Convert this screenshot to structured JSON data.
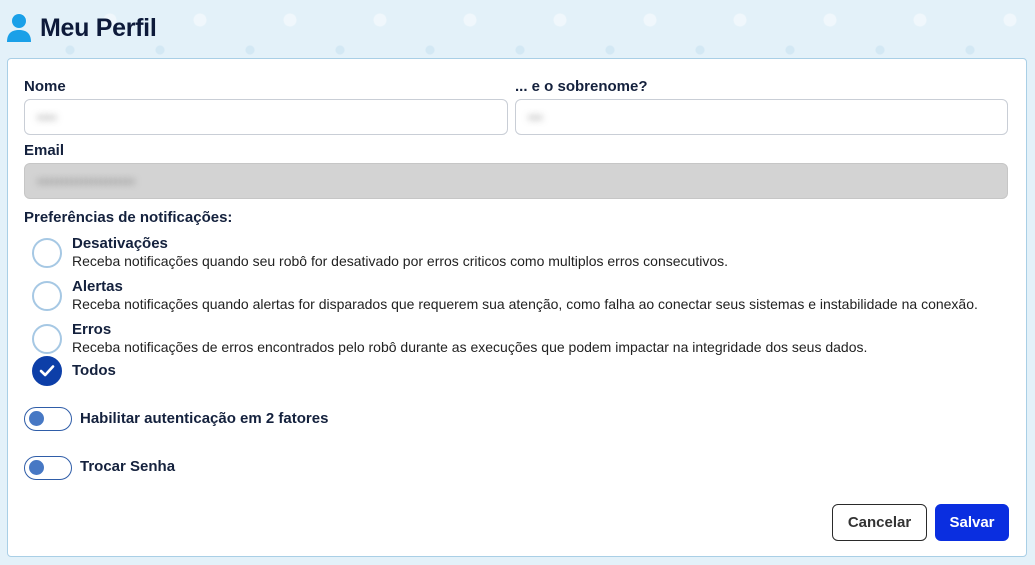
{
  "header": {
    "icon": "user-icon",
    "title": "Meu Perfil"
  },
  "form": {
    "first_name": {
      "label": "Nome",
      "value": "••••",
      "placeholder": ""
    },
    "last_name": {
      "label": "... e o sobrenome?",
      "value": "•••",
      "placeholder": ""
    },
    "email": {
      "label": "Email",
      "value": "••••••••••••••••••••",
      "disabled": true
    }
  },
  "notifications": {
    "title": "Preferências de notificações:",
    "options": [
      {
        "label": "Desativações",
        "description": "Receba notificações quando seu robô for desativado por erros criticos como multiplos erros consecutivos.",
        "checked": false
      },
      {
        "label": "Alertas",
        "description": "Receba notificações quando alertas for disparados que requerem sua atenção, como falha ao conectar seus sistemas e instabilidade na conexão.",
        "checked": false
      },
      {
        "label": "Erros",
        "description": "Receba notificações de erros encontrados pelo robô durante as execuções que podem impactar na integridade dos seus dados.",
        "checked": false
      },
      {
        "label": "Todos",
        "description": "",
        "checked": true
      }
    ]
  },
  "toggles": {
    "two_factor": {
      "label": "Habilitar autenticação em 2 fatores",
      "on": false
    },
    "change_password": {
      "label": "Trocar Senha",
      "on": false
    }
  },
  "actions": {
    "cancel_label": "Cancelar",
    "save_label": "Salvar"
  },
  "colors": {
    "accent": "#0a2ee0",
    "radio_checked": "#0d3fa8",
    "toggle_knob": "#4778c4",
    "header_icon": "#1aa0e8"
  }
}
